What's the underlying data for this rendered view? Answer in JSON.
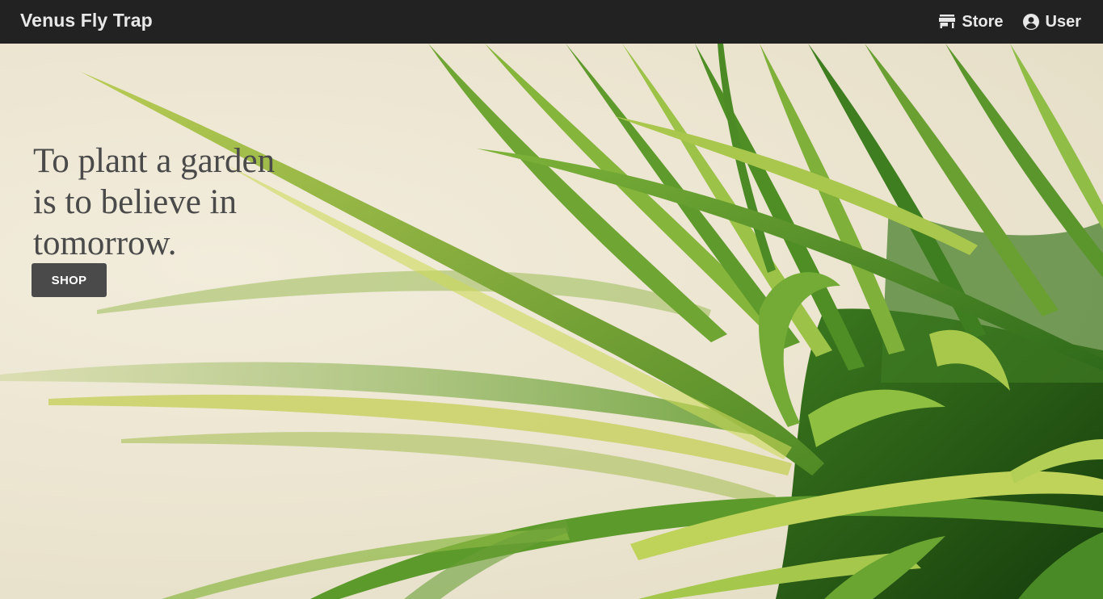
{
  "navbar": {
    "brand": "Venus Fly Trap",
    "links": [
      {
        "label": "Store",
        "icon": "store-icon"
      },
      {
        "label": "User",
        "icon": "user-circle-icon"
      }
    ],
    "background": "#222222",
    "text_color": "#e8e8e8"
  },
  "hero": {
    "quote": "To plant a garden is to believe in tomorrow.",
    "button_label": "SHOP",
    "button_color": "#4a4a4a",
    "background_image": "green plant leaves on cream background",
    "background_color": "#ece6d3"
  }
}
